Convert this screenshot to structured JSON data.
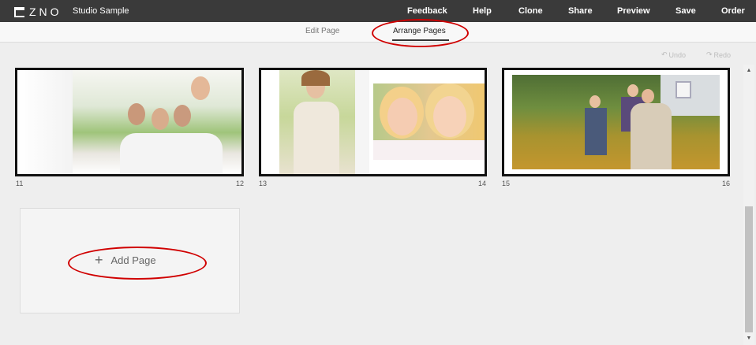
{
  "app": {
    "logo_text": "ZNO",
    "project_name": "Studio Sample"
  },
  "nav": {
    "feedback": "Feedback",
    "help": "Help",
    "clone": "Clone",
    "share": "Share",
    "preview": "Preview",
    "save": "Save",
    "order": "Order"
  },
  "tabs": {
    "edit": "Edit Page",
    "arrange": "Arrange Pages"
  },
  "history": {
    "undo": "Undo",
    "redo": "Redo"
  },
  "spreads": [
    {
      "left_page": "11",
      "right_page": "12"
    },
    {
      "left_page": "13",
      "right_page": "14"
    },
    {
      "left_page": "15",
      "right_page": "16"
    }
  ],
  "add_page": {
    "label": "Add Page"
  },
  "colors": {
    "topbar": "#3a3a3a",
    "annotation": "#d00000"
  }
}
